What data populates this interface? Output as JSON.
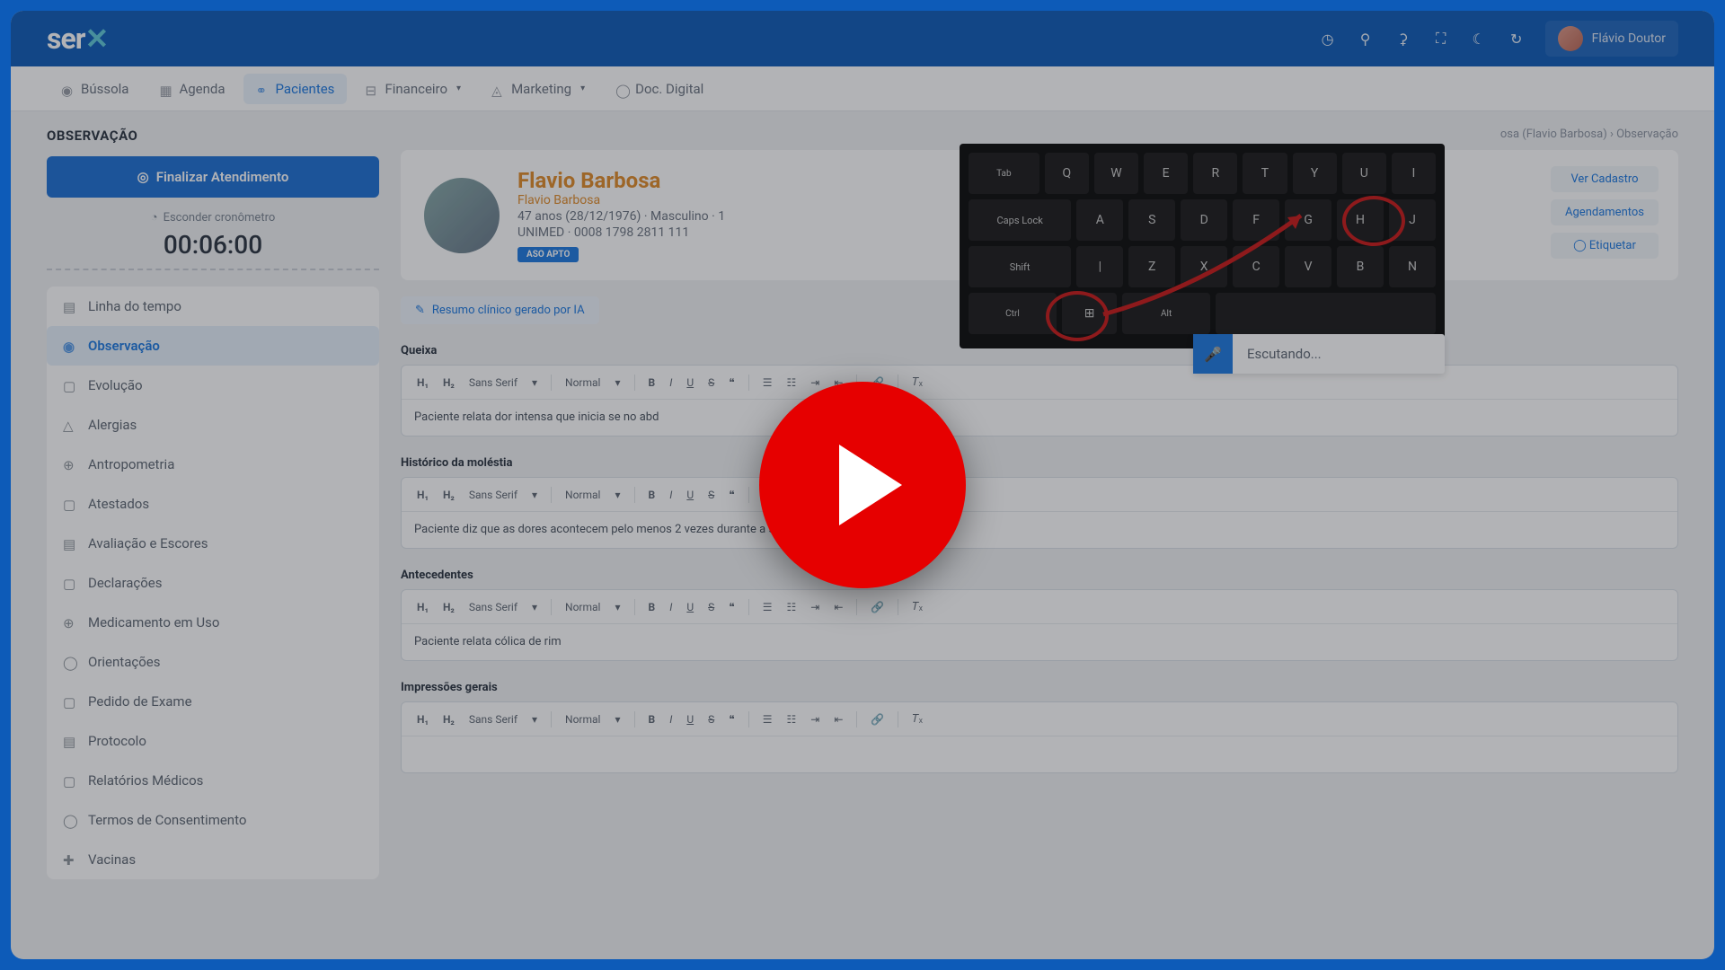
{
  "brand": "ser",
  "user_name": "Flávio Doutor",
  "nav": {
    "bussola": "Bússola",
    "agenda": "Agenda",
    "pacientes": "Pacientes",
    "financeiro": "Financeiro",
    "marketing": "Marketing",
    "doc_digital": "Doc. Digital"
  },
  "page_title": "OBSERVAÇÃO",
  "finalize_btn": "Finalizar Atendimento",
  "hide_timer": "Esconder cronômetro",
  "timer": "00:06:00",
  "sidebar": {
    "items": [
      {
        "label": "Linha do tempo"
      },
      {
        "label": "Observação"
      },
      {
        "label": "Evolução"
      },
      {
        "label": "Alergias"
      },
      {
        "label": "Antropometria"
      },
      {
        "label": "Atestados"
      },
      {
        "label": "Avaliação e Escores"
      },
      {
        "label": "Declarações"
      },
      {
        "label": "Medicamento em Uso"
      },
      {
        "label": "Orientações"
      },
      {
        "label": "Pedido de Exame"
      },
      {
        "label": "Protocolo"
      },
      {
        "label": "Relatórios Médicos"
      },
      {
        "label": "Termos de Consentimento"
      },
      {
        "label": "Vacinas"
      }
    ]
  },
  "breadcrumb": "osa (Flavio Barbosa)  ›  Observação",
  "patient": {
    "name": "Flavio Barbosa",
    "sub": "Flavio Barbosa",
    "meta": "47 anos (28/12/1976) · Masculino · 1",
    "plan": "UNIMED · 0008 1798 2811 111",
    "badge": "ASO APTO",
    "actions": {
      "cadastro": "Ver Cadastro",
      "agend": "Agendamentos",
      "etiq": "Etiquetar"
    }
  },
  "ai_summary": "Resumo clínico gerado por IA",
  "sections": {
    "queixa": {
      "label": "Queixa",
      "text": "Paciente relata dor intensa que inicia se no abd"
    },
    "historico": {
      "label": "Histórico da moléstia",
      "text": "Paciente diz que as dores acontecem pelo menos 2 vezes durante a semana."
    },
    "antecedentes": {
      "label": "Antecedentes",
      "text": "Paciente relata cólica de rim"
    },
    "impressoes": {
      "label": "Impressões gerais",
      "text": ""
    }
  },
  "editor_toolbar": {
    "h1": "H₁",
    "h2": "H₂",
    "font": "Sans Serif",
    "size": "Normal",
    "bold": "B",
    "italic": "I",
    "underline": "U",
    "strike": "S",
    "quote": "❝"
  },
  "listening": "Escutando...",
  "keyboard": {
    "r1": [
      "Tab",
      "Q",
      "W",
      "E",
      "R",
      "T",
      "Y",
      "U",
      "I"
    ],
    "r2": [
      "Caps Lock",
      "A",
      "S",
      "D",
      "F",
      "G",
      "H",
      "J"
    ],
    "r3": [
      "Shift",
      "|",
      "Z",
      "X",
      "C",
      "V",
      "B",
      "N"
    ],
    "r4": [
      "Ctrl",
      "⊞",
      "Alt"
    ]
  }
}
